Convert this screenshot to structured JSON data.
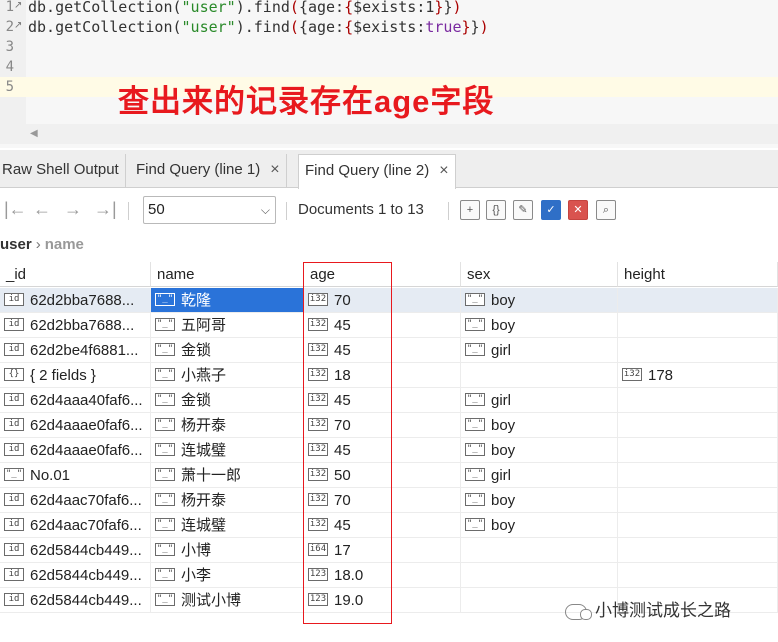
{
  "editor": {
    "lines": [
      {
        "num": "1",
        "parts": [
          [
            "t",
            "db.getCollection("
          ],
          [
            "str",
            "\"user\""
          ],
          [
            "t",
            ").find"
          ],
          [
            "br",
            "("
          ],
          [
            "t",
            "{age:"
          ],
          [
            "br",
            "{"
          ],
          [
            "t",
            "$exists:1"
          ],
          [
            "br",
            "}"
          ],
          [
            "t",
            "}"
          ],
          [
            "br",
            ")"
          ]
        ]
      },
      {
        "num": "2",
        "parts": [
          [
            "t",
            "db.getCollection("
          ],
          [
            "str",
            "\"user\""
          ],
          [
            "t",
            ").find"
          ],
          [
            "br",
            "("
          ],
          [
            "t",
            "{age:"
          ],
          [
            "br",
            "{"
          ],
          [
            "t",
            "$exists:"
          ],
          [
            "kw",
            "true"
          ],
          [
            "br",
            "}"
          ],
          [
            "t",
            "}"
          ],
          [
            "br",
            ")"
          ]
        ]
      },
      {
        "num": "3",
        "parts": []
      },
      {
        "num": "4",
        "parts": []
      },
      {
        "num": "5",
        "parts": []
      }
    ],
    "annotation": "查出来的记录存在age字段"
  },
  "tabs": [
    {
      "label": "Raw Shell Output",
      "active": false,
      "closable": false
    },
    {
      "label": "Find Query (line 1)",
      "active": false,
      "closable": true
    },
    {
      "label": "Find Query (line 2)",
      "active": true,
      "closable": true
    }
  ],
  "toolbar": {
    "page_size": "50",
    "documents_label": "Documents 1 to 13"
  },
  "breadcrumb": {
    "collection": "user",
    "field": "name"
  },
  "grid": {
    "columns": [
      "_id",
      "name",
      "age",
      "sex",
      "height"
    ],
    "rows": [
      {
        "id": [
          "id",
          "62d2bba7688..."
        ],
        "name": [
          "\"_\"",
          "乾隆"
        ],
        "age": [
          "i32",
          "70"
        ],
        "sex": [
          "\"_\"",
          "boy"
        ],
        "height": null,
        "selected": true
      },
      {
        "id": [
          "id",
          "62d2bba7688..."
        ],
        "name": [
          "\"_\"",
          "五阿哥"
        ],
        "age": [
          "i32",
          "45"
        ],
        "sex": [
          "\"_\"",
          "boy"
        ],
        "height": null
      },
      {
        "id": [
          "id",
          "62d2be4f6881..."
        ],
        "name": [
          "\"_\"",
          "金锁"
        ],
        "age": [
          "i32",
          "45"
        ],
        "sex": [
          "\"_\"",
          "girl"
        ],
        "height": null
      },
      {
        "id": [
          "{}",
          "{ 2 fields }"
        ],
        "name": [
          "\"_\"",
          "小燕子"
        ],
        "age": [
          "i32",
          "18"
        ],
        "sex": null,
        "height": [
          "i32",
          "178"
        ]
      },
      {
        "id": [
          "id",
          "62d4aaa40faf6..."
        ],
        "name": [
          "\"_\"",
          "金锁"
        ],
        "age": [
          "i32",
          "45"
        ],
        "sex": [
          "\"_\"",
          "girl"
        ],
        "height": null
      },
      {
        "id": [
          "id",
          "62d4aaae0faf6..."
        ],
        "name": [
          "\"_\"",
          "杨开泰"
        ],
        "age": [
          "i32",
          "70"
        ],
        "sex": [
          "\"_\"",
          "boy"
        ],
        "height": null
      },
      {
        "id": [
          "id",
          "62d4aaae0faf6..."
        ],
        "name": [
          "\"_\"",
          "连城璧"
        ],
        "age": [
          "i32",
          "45"
        ],
        "sex": [
          "\"_\"",
          "boy"
        ],
        "height": null
      },
      {
        "id": [
          "\"_\"",
          "No.01"
        ],
        "name": [
          "\"_\"",
          "萧十一郎"
        ],
        "age": [
          "i32",
          "50"
        ],
        "sex": [
          "\"_\"",
          "girl"
        ],
        "height": null
      },
      {
        "id": [
          "id",
          "62d4aac70faf6..."
        ],
        "name": [
          "\"_\"",
          "杨开泰"
        ],
        "age": [
          "i32",
          "70"
        ],
        "sex": [
          "\"_\"",
          "boy"
        ],
        "height": null
      },
      {
        "id": [
          "id",
          "62d4aac70faf6..."
        ],
        "name": [
          "\"_\"",
          "连城璧"
        ],
        "age": [
          "i32",
          "45"
        ],
        "sex": [
          "\"_\"",
          "boy"
        ],
        "height": null
      },
      {
        "id": [
          "id",
          "62d5844cb449..."
        ],
        "name": [
          "\"_\"",
          "小博"
        ],
        "age": [
          "i64",
          "17"
        ],
        "sex": null,
        "height": null
      },
      {
        "id": [
          "id",
          "62d5844cb449..."
        ],
        "name": [
          "\"_\"",
          "小李"
        ],
        "age": [
          "123",
          "18.0"
        ],
        "sex": null,
        "height": null
      },
      {
        "id": [
          "id",
          "62d5844cb449..."
        ],
        "name": [
          "\"_\"",
          "测试小博"
        ],
        "age": [
          "123",
          "19.0"
        ],
        "sex": null,
        "height": null
      }
    ]
  },
  "watermark": "小博测试成长之路"
}
